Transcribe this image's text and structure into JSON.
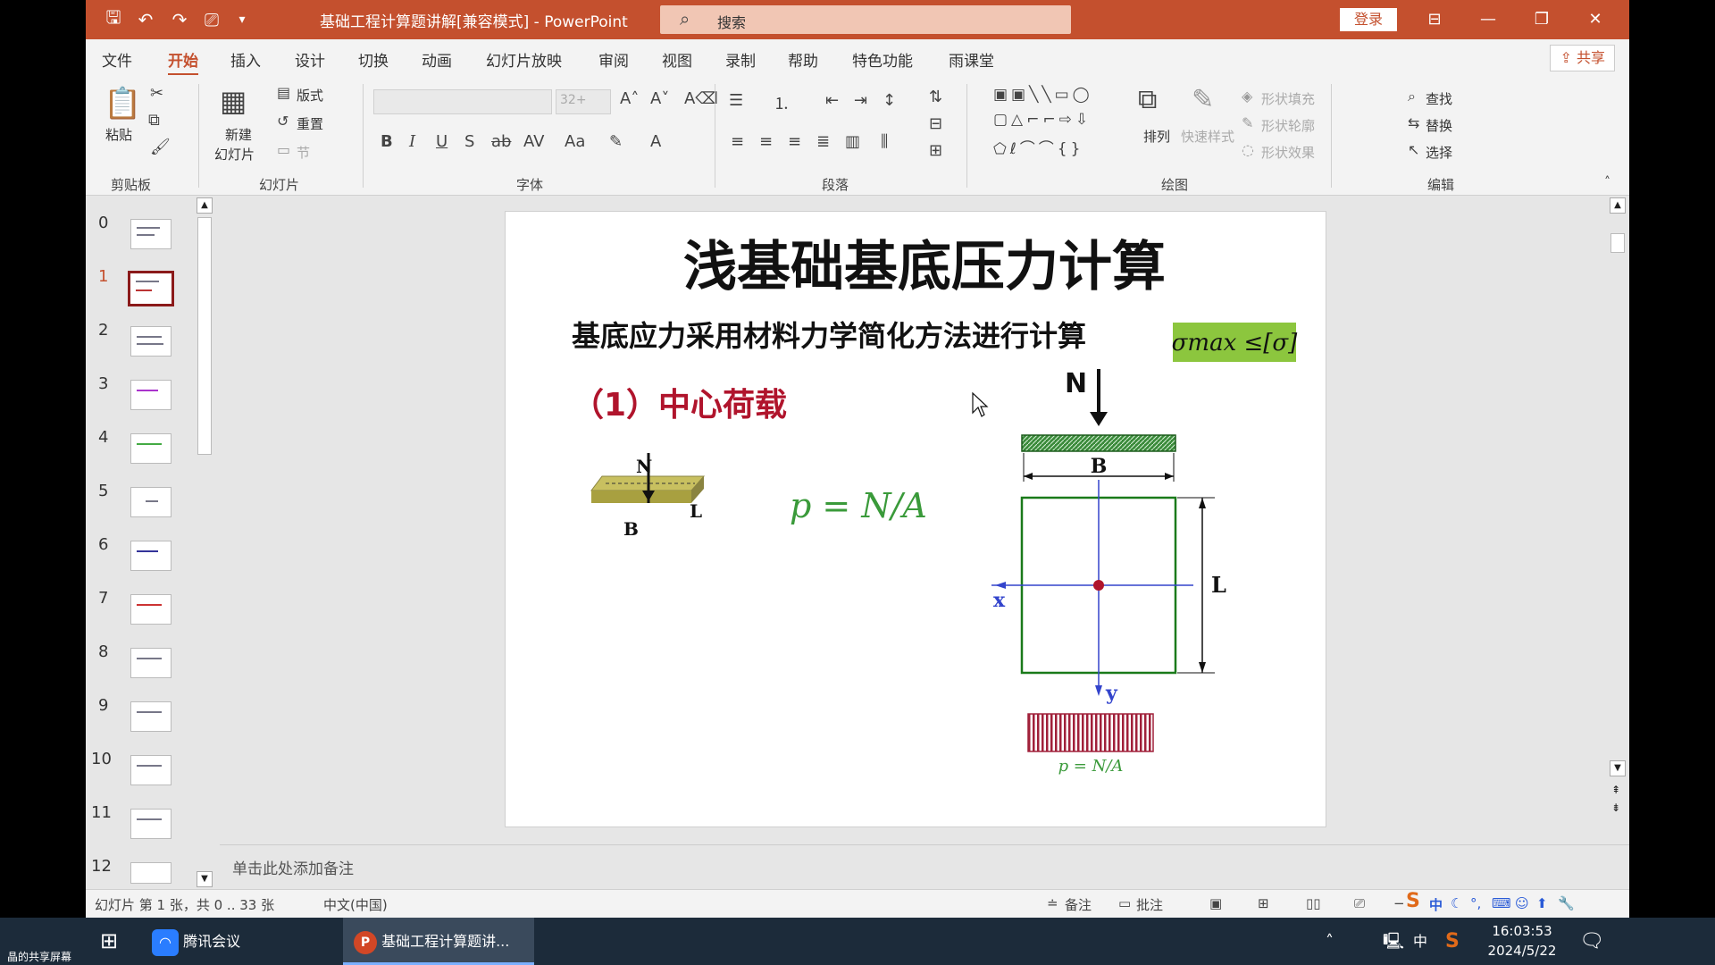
{
  "window": {
    "doc_title": "基础工程计算题讲解[兼容模式] - PowerPoint",
    "search_placeholder": "搜索",
    "login": "登录",
    "share": "共享"
  },
  "tabs": [
    "文件",
    "开始",
    "插入",
    "设计",
    "切换",
    "动画",
    "幻灯片放映",
    "审阅",
    "视图",
    "录制",
    "帮助",
    "特色功能",
    "雨课堂"
  ],
  "active_tab": "开始",
  "ribbon": {
    "clipboard": {
      "paste": "粘贴",
      "label": "剪贴板"
    },
    "slides": {
      "new_slide_line1": "新建",
      "new_slide_line2": "幻灯片",
      "layout": "版式",
      "reset": "重置",
      "section": "节",
      "label": "幻灯片"
    },
    "font": {
      "size": "32+",
      "label": "字体"
    },
    "paragraph": {
      "label": "段落"
    },
    "drawing": {
      "arrange": "排列",
      "quick_styles": "快速样式",
      "shape_fill": "形状填充",
      "shape_outline": "形状轮廓",
      "shape_effects": "形状效果",
      "label": "绘图"
    },
    "editing": {
      "find": "查找",
      "replace": "替换",
      "select": "选择",
      "label": "编辑"
    }
  },
  "thumbnails": [
    "0",
    "1",
    "2",
    "3",
    "4",
    "5",
    "6",
    "7",
    "8",
    "9",
    "10",
    "11",
    "12"
  ],
  "selected_slide": "1",
  "slide": {
    "title": "浅基础基底压力计算",
    "subtitle": "基底应力采用材料力学简化方法进行计算",
    "formula_box": "σmax ≤[σ]",
    "section_heading": "（1）中心荷载",
    "formula": "p = N/A",
    "small_fig": {
      "n": "N",
      "l": "L",
      "b": "B"
    },
    "big_fig": {
      "n": "N",
      "b": "B",
      "l": "L",
      "x": "x",
      "y": "y",
      "p": "p = N/A"
    }
  },
  "notes_placeholder": "单击此处添加备注",
  "status": {
    "slide_info": "幻灯片 第 1 张，共 0 .. 33 张",
    "language": "中文(中国)",
    "notes": "备注",
    "comments": "批注"
  },
  "taskbar": {
    "meeting_app": "腾讯会议",
    "ppt_app": "基础工程计算题讲...",
    "ime": "中",
    "time": "16:03:53",
    "date": "2024/5/22",
    "screen_share": "晶的共享屏幕"
  },
  "colors": {
    "accent": "#c4502e",
    "slide_title": "#111111",
    "heading_red": "#b0142c",
    "formula_green": "#3a9a3a",
    "highlight_green": "#8cc63e",
    "axis_blue": "#3344cc",
    "load_red": "#a0203a"
  }
}
